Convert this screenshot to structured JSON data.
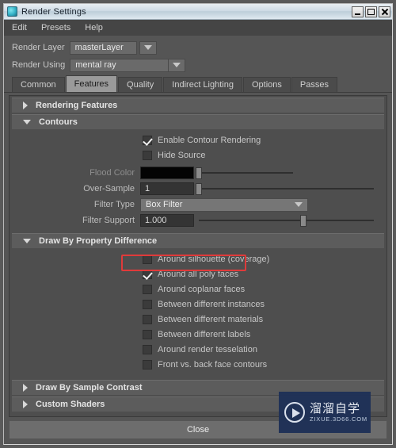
{
  "window": {
    "title": "Render Settings",
    "icon": "maya-app-icon",
    "controls": {
      "minimize": "minimize-button",
      "maximize": "maximize-button",
      "close": "close-button"
    }
  },
  "menubar": {
    "items": [
      "Edit",
      "Presets",
      "Help"
    ]
  },
  "render_layer": {
    "label": "Render Layer",
    "value": "masterLayer"
  },
  "render_using": {
    "label": "Render Using",
    "value": "mental ray"
  },
  "tabs": [
    {
      "label": "Common",
      "active": false
    },
    {
      "label": "Features",
      "active": true
    },
    {
      "label": "Quality",
      "active": false
    },
    {
      "label": "Indirect Lighting",
      "active": false
    },
    {
      "label": "Options",
      "active": false
    },
    {
      "label": "Passes",
      "active": false
    }
  ],
  "sections": {
    "rendering_features": {
      "title": "Rendering Features",
      "expanded": false
    },
    "contours": {
      "title": "Contours",
      "expanded": true
    },
    "draw_by_property_difference": {
      "title": "Draw By Property Difference",
      "expanded": true
    },
    "draw_by_sample_contrast": {
      "title": "Draw By Sample Contrast",
      "expanded": false
    },
    "custom_shaders": {
      "title": "Custom Shaders",
      "expanded": false
    }
  },
  "contours": {
    "enable_contour_rendering": {
      "label": "Enable Contour Rendering",
      "checked": true
    },
    "hide_source": {
      "label": "Hide Source",
      "checked": false
    },
    "flood_color": {
      "label": "Flood Color",
      "value": "#040404",
      "disabled": true
    },
    "over_sample": {
      "label": "Over-Sample",
      "value": "1"
    },
    "filter_type": {
      "label": "Filter Type",
      "value": "Box Filter"
    },
    "filter_support": {
      "label": "Filter Support",
      "value": "1.000"
    }
  },
  "property_difference": [
    {
      "label": "Around silhouette (coverage)",
      "checked": false,
      "highlighted": false
    },
    {
      "label": "Around all poly faces",
      "checked": true,
      "highlighted": true
    },
    {
      "label": "Around coplanar faces",
      "checked": false,
      "highlighted": false
    },
    {
      "label": "Between different instances",
      "checked": false,
      "highlighted": false
    },
    {
      "label": "Between different materials",
      "checked": false,
      "highlighted": false
    },
    {
      "label": "Between different labels",
      "checked": false,
      "highlighted": false
    },
    {
      "label": "Around render tesselation",
      "checked": false,
      "highlighted": false
    },
    {
      "label": "Front vs. back face contours",
      "checked": false,
      "highlighted": false
    }
  ],
  "footer": {
    "close_label": "Close"
  },
  "watermark": {
    "cn": "溜溜自学",
    "en": "ZIXUE.3D66.COM",
    "color": "#1f3157"
  },
  "annotation": {
    "color": "#e03a3a",
    "target": "Around all poly faces"
  }
}
